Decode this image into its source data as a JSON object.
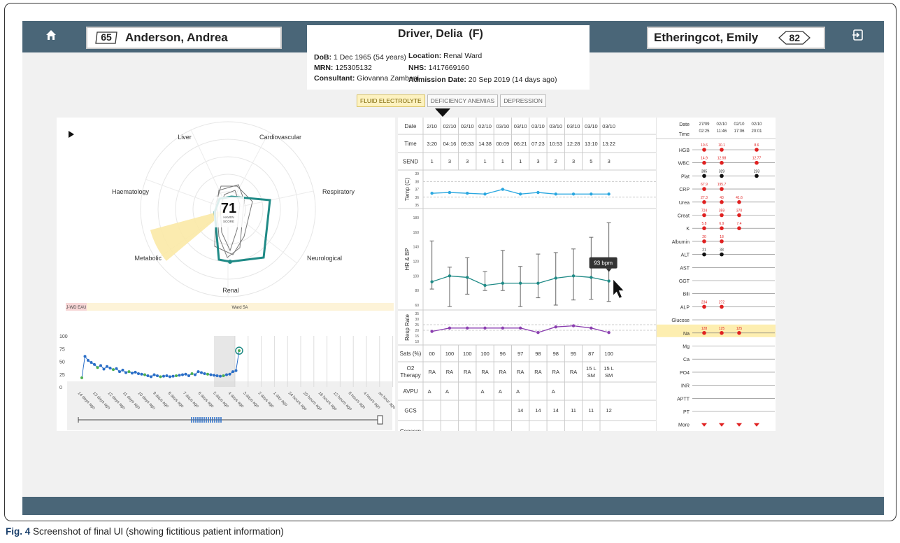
{
  "header": {
    "patient_name": "Driver, Delia",
    "sex": "(F)",
    "dob_label": "DoB:",
    "dob": "1 Dec 1965 (54 years)",
    "mrn_label": "MRN:",
    "mrn": "125305132",
    "consultant_label": "Consultant:",
    "consultant": "Giovanna Zamboni",
    "location_label": "Location:",
    "location": "Renal Ward",
    "nhs_label": "NHS:",
    "nhs": "1417669160",
    "admission_label": "Admission Date:",
    "admission": "20 Sep 2019 (14 days ago)"
  },
  "left_patient": {
    "score": "65",
    "name": "Anderson, Andrea"
  },
  "right_patient": {
    "name": "Etheringcot, Emily",
    "score": "82"
  },
  "tabs": [
    {
      "label": "FLUID ELECTROLYTE",
      "active": true
    },
    {
      "label": "DEFICIENCY ANEMIAS",
      "active": false
    },
    {
      "label": "DEPRESSION",
      "active": false
    }
  ],
  "radar": {
    "axes": [
      "Liver",
      "Cardiovascular",
      "Respiratory",
      "Neurological",
      "Renal",
      "Metabolic",
      "Haematology"
    ],
    "score": "71",
    "score_label": "HAVEN SCORE",
    "ward_left": "J-WD EAU",
    "ward_right": "Ward 5A"
  },
  "trend": {
    "y_ticks": [
      "100",
      "75",
      "50",
      "25",
      "0"
    ],
    "values": [
      18,
      60,
      52,
      48,
      44,
      38,
      42,
      35,
      40,
      37,
      34,
      36,
      30,
      33,
      28,
      30,
      27,
      29,
      26,
      25,
      24,
      22,
      20,
      24,
      22,
      20,
      21,
      22,
      20,
      21,
      22,
      23,
      24,
      25,
      22,
      26,
      24,
      30,
      28,
      26,
      25,
      24,
      23,
      22,
      21,
      22,
      24,
      25,
      30,
      32,
      71
    ],
    "x_labels": [
      "14 days ago",
      "13 days ago",
      "12 days ago",
      "11 days ago",
      "10 days ago",
      "9 days ago",
      "8 days ago",
      "7 days ago",
      "6 days ago",
      "5 days ago",
      "4 days ago",
      "3 days ago",
      "2 days ago",
      "1 day ago",
      "24 hours ago",
      "20 hours ago",
      "16 hours ago",
      "12 hours ago",
      "8 hours ago",
      "4 hours ago",
      "an hour ago"
    ]
  },
  "obs": {
    "row_labels": {
      "date": "Date",
      "time": "Time",
      "send": "SEND",
      "temp": "Temp (C)",
      "hrbp": "HR & BP",
      "resp": "Resp Rate",
      "sats": "Sats (%)",
      "o2": "O2 Therapy",
      "avpu": "AVPU",
      "gcs": "GCS",
      "concern": "Concern"
    },
    "dates": [
      "2/10",
      "02/10",
      "02/10",
      "02/10",
      "03/10",
      "03/10",
      "03/10",
      "03/10",
      "03/10",
      "03/10",
      "03/10"
    ],
    "times": [
      "3:20",
      "04:16",
      "09:33",
      "14:38",
      "00:09",
      "06:21",
      "07:23",
      "10:53",
      "12:28",
      "13:10",
      "13:22"
    ],
    "send": [
      "1",
      "3",
      "3",
      "1",
      "1",
      "1",
      "3",
      "2",
      "3",
      "5",
      "3"
    ],
    "temp_ticks": [
      "39",
      "38",
      "37",
      "36",
      "35"
    ],
    "temp_values": [
      36.5,
      36.6,
      36.5,
      36.4,
      37.0,
      36.4,
      36.6,
      36.4,
      36.4,
      36.4,
      36.4
    ],
    "hr_ticks": [
      "180",
      "160",
      "140",
      "120",
      "100",
      "80",
      "60"
    ],
    "hr_values": [
      92,
      100,
      98,
      87,
      90,
      90,
      90,
      97,
      100,
      98,
      93
    ],
    "bp_ranges": [
      [
        82,
        148
      ],
      [
        58,
        112
      ],
      [
        75,
        125
      ],
      [
        80,
        106
      ],
      [
        80,
        135
      ],
      [
        58,
        113
      ],
      [
        70,
        130
      ],
      [
        60,
        132
      ],
      [
        67,
        137
      ],
      [
        68,
        153
      ],
      [
        65,
        173
      ]
    ],
    "resp_ticks": [
      "35",
      "30",
      "25",
      "20",
      "15",
      "10"
    ],
    "resp_values": [
      19,
      22,
      22,
      22,
      22,
      22,
      18,
      23,
      24,
      22,
      18
    ],
    "sats": [
      "00",
      "100",
      "100",
      "100",
      "96",
      "97",
      "98",
      "98",
      "95",
      "87",
      "100"
    ],
    "o2": [
      "RA",
      "RA",
      "RA",
      "RA",
      "RA",
      "RA",
      "RA",
      "RA",
      "RA",
      "15 L SM",
      "15 L SM"
    ],
    "avpu": [
      "A",
      "A",
      "",
      "A",
      "A",
      "A",
      "",
      "A",
      "",
      "",
      ""
    ],
    "gcs": [
      "",
      "",
      "",
      "",
      "",
      "14",
      "14",
      "14",
      "11",
      "11",
      "12"
    ],
    "tooltip": "93 bpm"
  },
  "labs": {
    "date_label": "Date",
    "time_label": "Time",
    "dates": [
      "27/09",
      "02/10",
      "02/10",
      "02/10"
    ],
    "times": [
      "02:25",
      "11:46",
      "17:06",
      "20:01"
    ],
    "rows": [
      {
        "name": "HGB",
        "values": [
          "10.6",
          "10.1",
          "",
          "8.6"
        ],
        "abnormal": true
      },
      {
        "name": "WBC",
        "values": [
          "14.9",
          "12.98",
          "",
          "12.77"
        ],
        "abnormal": true
      },
      {
        "name": "Plat",
        "values": [
          "395",
          "329",
          "",
          "233"
        ],
        "abnormal": false
      },
      {
        "name": "CRP",
        "values": [
          "67.9",
          "195.7",
          "",
          ""
        ],
        "abnormal": true
      },
      {
        "name": "Urea",
        "values": [
          "27.3",
          "43",
          "41.6",
          ""
        ],
        "abnormal": true
      },
      {
        "name": "Creat",
        "values": [
          "724",
          "359",
          "370",
          ""
        ],
        "abnormal": true
      },
      {
        "name": "K",
        "values": [
          "5.8",
          "6.9",
          "7.4",
          ""
        ],
        "abnormal": true
      },
      {
        "name": "Albumin",
        "values": [
          "20",
          "18",
          "",
          ""
        ],
        "abnormal": true
      },
      {
        "name": "ALT",
        "values": [
          "21",
          "33",
          "",
          ""
        ],
        "abnormal": false
      },
      {
        "name": "AST",
        "values": [
          "",
          "",
          "",
          ""
        ],
        "abnormal": false
      },
      {
        "name": "GGT",
        "values": [
          "",
          "",
          "",
          ""
        ],
        "abnormal": false
      },
      {
        "name": "Bili",
        "values": [
          "",
          "",
          "",
          ""
        ],
        "abnormal": false
      },
      {
        "name": "ALP",
        "values": [
          "234",
          "272",
          "",
          ""
        ],
        "abnormal": true
      },
      {
        "name": "Glucose",
        "values": [
          "",
          "",
          "",
          ""
        ],
        "abnormal": false
      },
      {
        "name": "Na",
        "values": [
          "128",
          "125",
          "125",
          ""
        ],
        "abnormal": true,
        "highlight": true
      },
      {
        "name": "Mg",
        "values": [
          "",
          "",
          "",
          ""
        ],
        "abnormal": false
      },
      {
        "name": "Ca",
        "values": [
          "",
          "",
          "",
          ""
        ],
        "abnormal": false
      },
      {
        "name": "PO4",
        "values": [
          "",
          "",
          "",
          ""
        ],
        "abnormal": false
      },
      {
        "name": "INR",
        "values": [
          "",
          "",
          "",
          ""
        ],
        "abnormal": false
      },
      {
        "name": "APTT",
        "values": [
          "",
          "",
          "",
          ""
        ],
        "abnormal": false
      },
      {
        "name": "PT",
        "values": [
          "",
          "",
          "",
          ""
        ],
        "abnormal": false
      }
    ],
    "more_label": "More"
  },
  "caption": {
    "label": "Fig. 4",
    "text": "Screenshot of final UI (showing fictitious patient information)"
  },
  "colors": {
    "bar": "#4a6678",
    "teal": "#1f8a86",
    "temp": "#2aa7e0",
    "resp": "#8b3fb0",
    "abnormal": "#e02020",
    "highlight": "#fdeeb0"
  }
}
